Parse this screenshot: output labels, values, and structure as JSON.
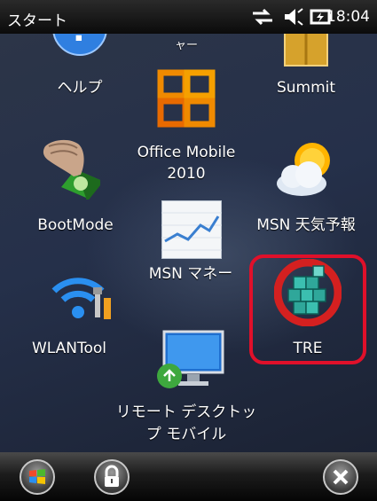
{
  "status_bar": {
    "title": "スタート",
    "time": "18:04",
    "icons": [
      "sync-arrows-icon",
      "volume-icon",
      "battery-charging-icon"
    ]
  },
  "home": {
    "tiles": [
      {
        "label": "ヘルプ",
        "icon": "help-icon"
      },
      {
        "label": "ャー",
        "icon": "partial-label"
      },
      {
        "label": "Summit",
        "icon": "folder-icon"
      },
      {
        "label_line1": "Office Mobile",
        "label_line2": "2010",
        "icon": "office-logo-icon"
      },
      {
        "label": "BootMode",
        "icon": "hand-press-button-icon"
      },
      {
        "label": "MSN 天気予報",
        "icon": "weather-sun-cloud-icon"
      },
      {
        "label": "MSN マネー",
        "icon": "stock-chart-icon"
      },
      {
        "label": "WLANTool",
        "icon": "wifi-tool-icon"
      },
      {
        "label": "TRE",
        "icon": "tre-cubes-icon"
      },
      {
        "label_line1": "リモート デスクトッ",
        "label_line2": "プ モバイル",
        "icon": "remote-desktop-icon"
      }
    ]
  },
  "soft_keys": [
    "windows-start-icon",
    "lock-icon",
    "close-icon"
  ],
  "colors": {
    "highlight": "#e0102a",
    "status_bar": "#111111"
  }
}
